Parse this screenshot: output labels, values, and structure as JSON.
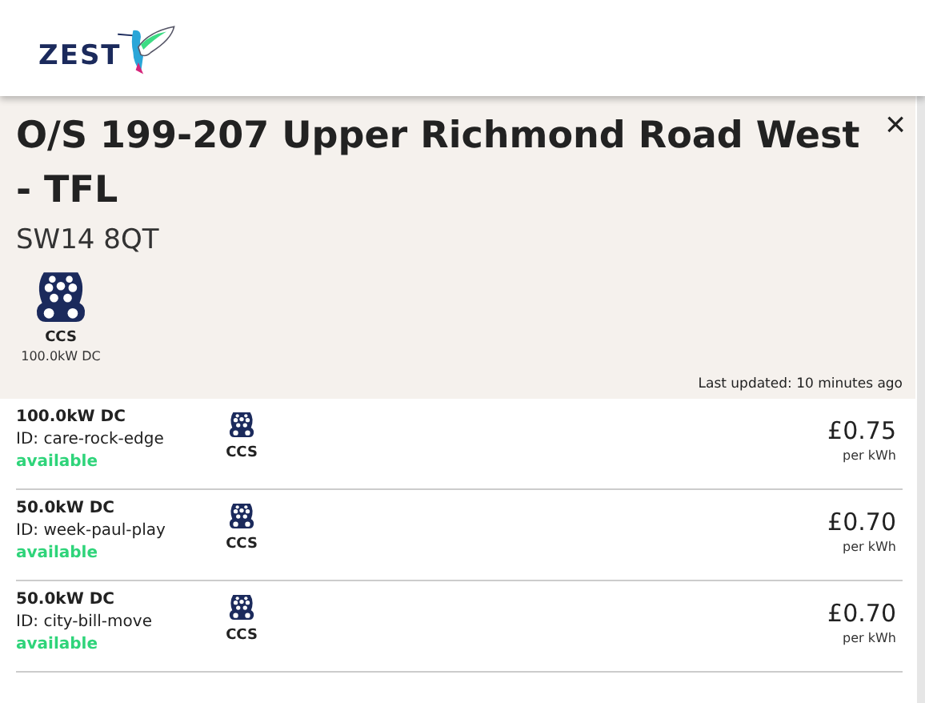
{
  "logo": {
    "text": "ZEST"
  },
  "location": {
    "title": "O/S 199-207 Upper Richmond Road West - TFL",
    "close": "×",
    "postcode": "SW14 8QT"
  },
  "connectors": [
    {
      "name": "CCS",
      "power": "100.0kW DC"
    }
  ],
  "last_updated": "Last updated: 10 minutes ago",
  "chargers": [
    {
      "power": "100.0kW DC",
      "id": "ID: care-rock-edge",
      "status": "available",
      "connector": "CCS",
      "price": "£0.75",
      "unit": "per kWh"
    },
    {
      "power": "50.0kW DC",
      "id": "ID: week-paul-play",
      "status": "available",
      "connector": "CCS",
      "price": "£0.70",
      "unit": "per kWh"
    },
    {
      "power": "50.0kW DC",
      "id": "ID: city-bill-move",
      "status": "available",
      "connector": "CCS",
      "price": "£0.70",
      "unit": "per kWh"
    }
  ]
}
